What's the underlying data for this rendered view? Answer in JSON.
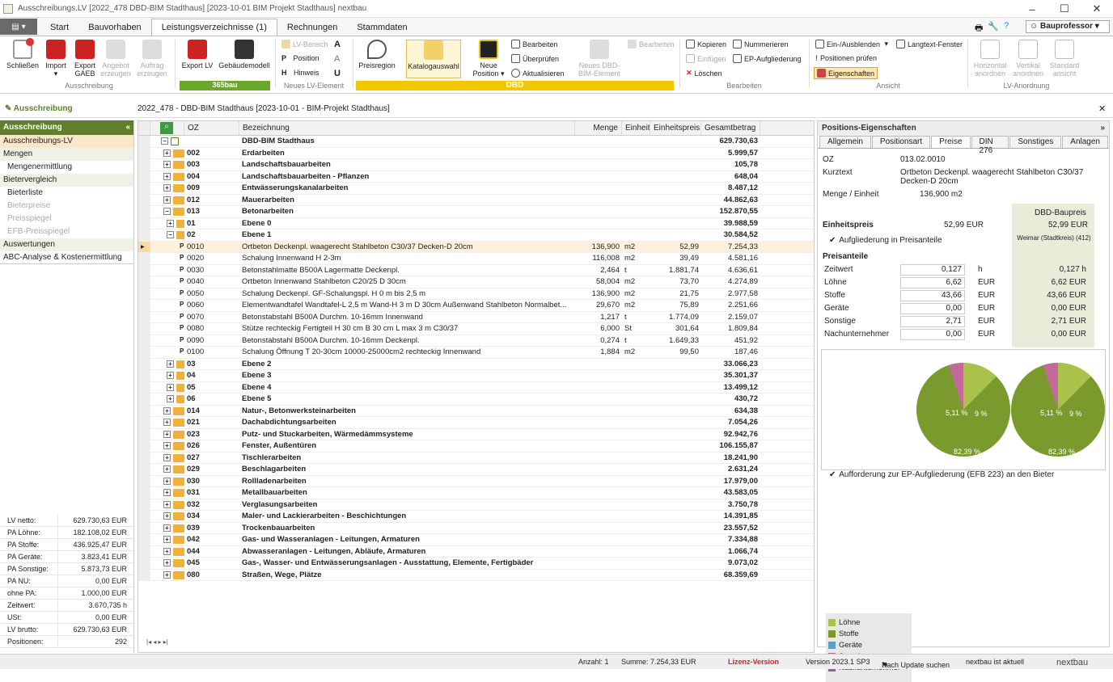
{
  "window": {
    "title": "Ausschreibungs.LV [2022_478    DBD-BIM Stadthaus]   [2023-10-01    BIM Projekt Stadthaus]    nextbau",
    "min": "–",
    "max": "☐",
    "close": "✕"
  },
  "ribbon_tabs": [
    "Start",
    "Bauvorhaben",
    "Leistungsverzeichnisse (1)",
    "Rechnungen",
    "Stammdaten"
  ],
  "user": "Bauprofessor",
  "ribbon": {
    "ausschreibung": {
      "schliessen": "Schließen",
      "import": "Import",
      "export_gaeb": "Export GAEB",
      "angebot": "Angebot erzeugen",
      "auftrag": "Auftrag erzeugen",
      "label": "Ausschreibung"
    },
    "b365": {
      "export_lv": "Export LV",
      "gebaeudemodell": "Gebäudemodell",
      "label": "365bau"
    },
    "neues": {
      "lv_bereich": "LV-Bereich",
      "position": "Position",
      "hinweis": "Hinweis",
      "label": "Neues LV-Element"
    },
    "dbd": {
      "preisregion": "Preisregion",
      "katalogauswahl": "Katalogauswahl",
      "neue_position": "Neue Position",
      "bearbeiten": "Bearbeiten",
      "ueberpruefen": "Überprüfen",
      "aktualisieren": "Aktualisieren",
      "neues_bim": "Neues DBD-BIM-Element",
      "bearbeiten2": "Bearbeiten",
      "brand": "DBD"
    },
    "edit": {
      "kopieren": "Kopieren",
      "einfuegen": "Einfügen",
      "loeschen": "Löschen",
      "nummerieren": "Nummerieren",
      "ep_aufgl": "EP-Aufgliederung",
      "label": "Bearbeiten"
    },
    "ansicht": {
      "einaus": "Ein-/Ausblenden",
      "langtext": "Langtext-Fenster",
      "pos_pruefen": "Positionen prüfen",
      "eigenschaften": "Eigenschaften",
      "label": "Ansicht"
    },
    "anordnung": {
      "horizontal": "Horizontal anordnen",
      "vertikal": "Vertikal anordnen",
      "standard": "Standard ansicht",
      "label": "LV-Anordnung"
    }
  },
  "infobar": {
    "left": "Ausschreibung",
    "path": "2022_478 - DBD-BIM Stadthaus [2023-10-01 - BIM-Projekt Stadthaus]",
    "close": "✕"
  },
  "left": {
    "header": "Ausschreibung",
    "items": [
      {
        "t": "Ausschreibungs-LV",
        "k": "sel"
      },
      {
        "t": "Mengen",
        "k": "sec"
      },
      {
        "t": "Mengenermittlung",
        "k": "sub"
      },
      {
        "t": "Bietervergleich",
        "k": "sec"
      },
      {
        "t": "Bieterliste",
        "k": "sub"
      },
      {
        "t": "Bieterpreise",
        "k": "dis"
      },
      {
        "t": "Preisspiegel",
        "k": "dis"
      },
      {
        "t": "EFB-Preisspiegel",
        "k": "dis"
      },
      {
        "t": "Auswertungen",
        "k": "sec"
      },
      {
        "t": "ABC-Analyse & Kostenermittlung",
        "k": "bord"
      }
    ],
    "stats": [
      [
        "LV netto:",
        "629.730,63 EUR"
      ],
      [
        "PA Löhne:",
        "182.108,02 EUR"
      ],
      [
        "PA Stoffe:",
        "436.925,47 EUR"
      ],
      [
        "PA Geräte:",
        "3.823,41 EUR"
      ],
      [
        "PA Sonstige:",
        "5.873,73 EUR"
      ],
      [
        "PA NU:",
        "0,00 EUR"
      ],
      [
        "ohne PA:",
        "1.000,00 EUR"
      ],
      [
        "Zeitwert:",
        "3.670,735 h"
      ],
      [
        "USt:",
        "0,00 EUR"
      ],
      [
        "LV brutto:",
        "629.730,63 EUR"
      ],
      [
        "Positionen:",
        "292"
      ]
    ]
  },
  "grid": {
    "headers": [
      "OZ",
      "Bezeichnung",
      "Menge",
      "Einheit",
      "Einheitspreis",
      "Gesamtbetrag"
    ],
    "rows": [
      {
        "l": 0,
        "t": "root",
        "oz": "",
        "bez": "DBD-BIM Stadthaus",
        "g": "629.730,63"
      },
      {
        "l": 1,
        "t": "f",
        "oz": "002",
        "bez": "Erdarbeiten",
        "g": "5.999,57"
      },
      {
        "l": 1,
        "t": "f",
        "oz": "003",
        "bez": "Landschaftsbauarbeiten",
        "g": "105,78"
      },
      {
        "l": 1,
        "t": "f",
        "oz": "004",
        "bez": "Landschaftsbauarbeiten - Pflanzen",
        "g": "648,04"
      },
      {
        "l": 1,
        "t": "f",
        "oz": "009",
        "bez": "Entwässerungskanalarbeiten",
        "g": "8.487,12"
      },
      {
        "l": 1,
        "t": "f",
        "oz": "012",
        "bez": "Mauerarbeiten",
        "g": "44.862,63"
      },
      {
        "l": 1,
        "t": "fo",
        "oz": "013",
        "bez": "Betonarbeiten",
        "g": "152.870,55"
      },
      {
        "l": 2,
        "t": "f",
        "oz": "01",
        "bez": "Ebene 0",
        "g": "39.988,59"
      },
      {
        "l": 2,
        "t": "fo",
        "oz": "02",
        "bez": "Ebene 1",
        "g": "30.584,52"
      },
      {
        "l": 3,
        "t": "p",
        "oz": "0010",
        "bez": "Ortbeton Deckenpl. waagerecht Stahlbeton C30/37 Decken-D 20cm",
        "m": "136,900",
        "e": "m2",
        "ep": "52,99",
        "g": "7.254,33",
        "hi": true
      },
      {
        "l": 3,
        "t": "p",
        "oz": "0020",
        "bez": "Schalung Innenwand H 2-3m",
        "m": "116,008",
        "e": "m2",
        "ep": "39,49",
        "g": "4.581,16"
      },
      {
        "l": 3,
        "t": "p",
        "oz": "0030",
        "bez": "Betonstahlmatte B500A Lagermatte Deckenpl.",
        "m": "2,464",
        "e": "t",
        "ep": "1.881,74",
        "g": "4.636,61"
      },
      {
        "l": 3,
        "t": "p",
        "oz": "0040",
        "bez": "Ortbeton Innenwand Stahlbeton C20/25 D 30cm",
        "m": "58,004",
        "e": "m2",
        "ep": "73,70",
        "g": "4.274,89"
      },
      {
        "l": 3,
        "t": "p",
        "oz": "0050",
        "bez": "Schalung Deckenpl. GF-Schalungspl. H 0 m bis 2,5 m",
        "m": "136,900",
        "e": "m2",
        "ep": "21,75",
        "g": "2.977,58"
      },
      {
        "l": 3,
        "t": "p",
        "oz": "0060",
        "bez": "Elementwandtafel Wandtafel-L 2,5 m Wand-H 3 m D 30cm Außenwand Stahlbeton Normalbet...",
        "m": "29,670",
        "e": "m2",
        "ep": "75,89",
        "g": "2.251,66"
      },
      {
        "l": 3,
        "t": "p",
        "oz": "0070",
        "bez": "Betonstabstahl B500A Durchm. 10-16mm Innenwand",
        "m": "1,217",
        "e": "t",
        "ep": "1.774,09",
        "g": "2.159,07"
      },
      {
        "l": 3,
        "t": "p",
        "oz": "0080",
        "bez": "Stütze rechteckig Fertigteil H 30 cm B 30 cm L max 3 m C30/37",
        "m": "6,000",
        "e": "St",
        "ep": "301,64",
        "g": "1.809,84"
      },
      {
        "l": 3,
        "t": "p",
        "oz": "0090",
        "bez": "Betonstabstahl B500A Durchm. 10-16mm Deckenpl.",
        "m": "0,274",
        "e": "t",
        "ep": "1.649,33",
        "g": "451,92"
      },
      {
        "l": 3,
        "t": "p",
        "oz": "0100",
        "bez": "Schalung Öffnung T 20-30cm 10000-25000cm2 rechteckig Innenwand",
        "m": "1,884",
        "e": "m2",
        "ep": "99,50",
        "g": "187,46"
      },
      {
        "l": 2,
        "t": "f",
        "oz": "03",
        "bez": "Ebene 2",
        "g": "33.066,23"
      },
      {
        "l": 2,
        "t": "f",
        "oz": "04",
        "bez": "Ebene 3",
        "g": "35.301,37"
      },
      {
        "l": 2,
        "t": "f",
        "oz": "05",
        "bez": "Ebene 4",
        "g": "13.499,12"
      },
      {
        "l": 2,
        "t": "f",
        "oz": "06",
        "bez": "Ebene 5",
        "g": "430,72"
      },
      {
        "l": 1,
        "t": "f",
        "oz": "014",
        "bez": "Natur-, Betonwerksteinarbeiten",
        "g": "634,38"
      },
      {
        "l": 1,
        "t": "f",
        "oz": "021",
        "bez": "Dachabdichtungsarbeiten",
        "g": "7.054,26"
      },
      {
        "l": 1,
        "t": "f",
        "oz": "023",
        "bez": "Putz- und Stuckarbeiten, Wärmedämmsysteme",
        "g": "92.942,76"
      },
      {
        "l": 1,
        "t": "f",
        "oz": "026",
        "bez": "Fenster, Außentüren",
        "g": "106.155,87"
      },
      {
        "l": 1,
        "t": "f",
        "oz": "027",
        "bez": "Tischlerarbeiten",
        "g": "18.241,90"
      },
      {
        "l": 1,
        "t": "f",
        "oz": "029",
        "bez": "Beschlagarbeiten",
        "g": "2.631,24"
      },
      {
        "l": 1,
        "t": "f",
        "oz": "030",
        "bez": "Rollladenarbeiten",
        "g": "17.979,00"
      },
      {
        "l": 1,
        "t": "f",
        "oz": "031",
        "bez": "Metallbauarbeiten",
        "g": "43.583,05"
      },
      {
        "l": 1,
        "t": "f",
        "oz": "032",
        "bez": "Verglasungsarbeiten",
        "g": "3.750,78"
      },
      {
        "l": 1,
        "t": "f",
        "oz": "034",
        "bez": "Maler- und Lackierarbeiten - Beschichtungen",
        "g": "14.391,85"
      },
      {
        "l": 1,
        "t": "f",
        "oz": "039",
        "bez": "Trockenbauarbeiten",
        "g": "23.557,52"
      },
      {
        "l": 1,
        "t": "f",
        "oz": "042",
        "bez": "Gas- und Wasseranlagen - Leitungen, Armaturen",
        "g": "7.334,88"
      },
      {
        "l": 1,
        "t": "f",
        "oz": "044",
        "bez": "Abwasseranlagen - Leitungen, Abläufe, Armaturen",
        "g": "1.066,74"
      },
      {
        "l": 1,
        "t": "f",
        "oz": "045",
        "bez": "Gas-, Wasser- und Entwässerungsanlagen - Ausstattung, Elemente, Fertigbäder",
        "g": "9.073,02"
      },
      {
        "l": 1,
        "t": "f",
        "oz": "080",
        "bez": "Straßen, Wege, Plätze",
        "g": "68.359,69"
      }
    ]
  },
  "right": {
    "header": "Positions-Eigenschaften",
    "tabs": [
      "Allgemein",
      "Positionsart",
      "Preise",
      "DIN 276",
      "Sonstiges",
      "Anlagen"
    ],
    "oz_label": "OZ",
    "oz": "013.02.0010",
    "kurz_label": "Kurztext",
    "kurz": "Ortbeton Deckenpl. waagerecht Stahlbeton C30/37 Decken-D 20cm",
    "menge_label": "Menge / Einheit",
    "menge": "136,900 m2",
    "dbd_title": "DBD-Baupreis",
    "ep_label": "Einheitspreis",
    "ep": "52,99 EUR",
    "ep_dbd": "52,99 EUR",
    "region": "Weimar (Stadtkreis) (412)",
    "aufgl": "Aufgliederung in Preisanteile",
    "preisanteile": "Preisanteile",
    "anteile": [
      {
        "k": "Zeitwert",
        "v": "0,127",
        "u": "h",
        "d": "0,127 h"
      },
      {
        "k": "Löhne",
        "v": "6,62",
        "u": "EUR",
        "d": "6,62 EUR"
      },
      {
        "k": "Stoffe",
        "v": "43,66",
        "u": "EUR",
        "d": "43,66 EUR"
      },
      {
        "k": "Geräte",
        "v": "0,00",
        "u": "EUR",
        "d": "0,00 EUR"
      },
      {
        "k": "Sonstige",
        "v": "2,71",
        "u": "EUR",
        "d": "2,71 EUR"
      },
      {
        "k": "Nachunternehmer",
        "v": "0,00",
        "u": "EUR",
        "d": "0,00 EUR"
      }
    ],
    "legend": [
      {
        "n": "Löhne",
        "c": "#a9c24a"
      },
      {
        "n": "Stoffe",
        "c": "#7a9a2e"
      },
      {
        "n": "Geräte",
        "c": "#5aa0c8"
      },
      {
        "n": "Sonstige",
        "c": "#c46a9a"
      },
      {
        "n": "Nachunternehmer",
        "c": "#8a6a8a"
      }
    ],
    "pie": {
      "big": "82,39 %",
      "small1": "5,11 %",
      "small2": "9 %"
    },
    "efb": "Aufforderung zur EP-Aufgliederung (EFB 223) an den Bieter"
  },
  "status": {
    "anzahl": "Anzahl: 1",
    "summe": "Summe: 7.254,33 EUR",
    "lizenz": "Lizenz-Version",
    "version": "Version 2023.1 SP3",
    "update": "Nach Update suchen",
    "aktuell": "nextbau ist aktuell",
    "brand": "nextbau"
  }
}
